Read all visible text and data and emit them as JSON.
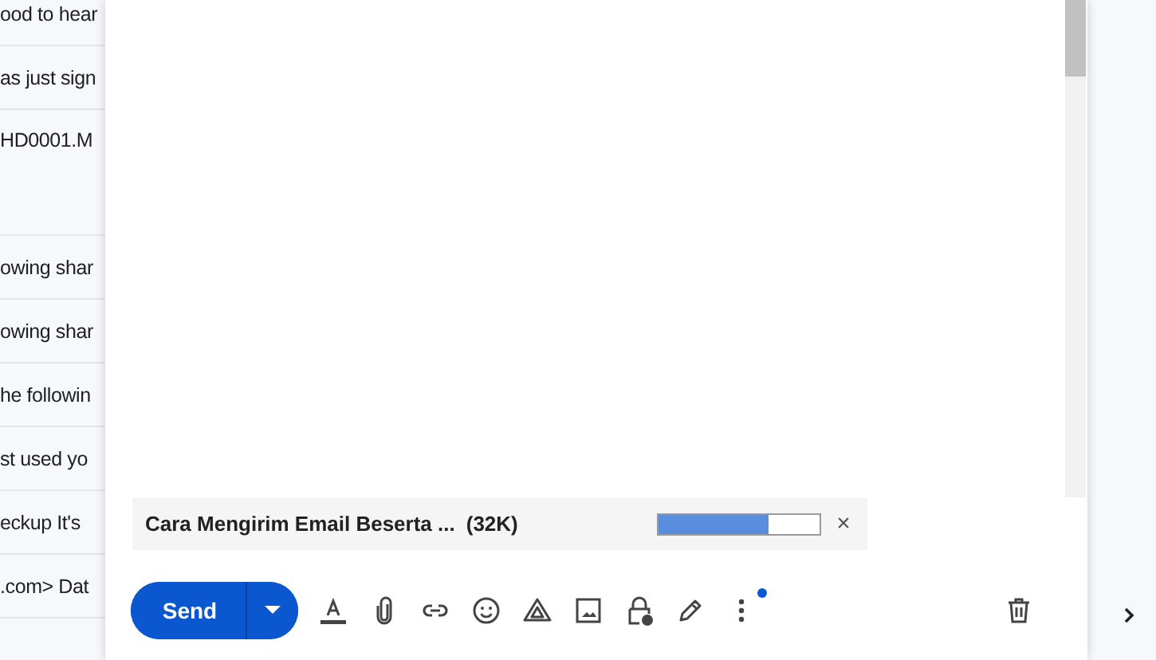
{
  "background_list": {
    "rows": [
      {
        "snippet": "ood to hear"
      },
      {
        "snippet": "as just sign"
      },
      {
        "snippet": "HD0001.M"
      },
      {
        "snippet": "owing shar"
      },
      {
        "snippet": "owing shar"
      },
      {
        "snippet": "he followin"
      },
      {
        "snippet": "st used yo"
      },
      {
        "snippet": "eckup It's"
      },
      {
        "snippet": ".com> Dat"
      }
    ]
  },
  "compose": {
    "attachment": {
      "name": "Cara Mengirim Email Beserta ...",
      "size": "(32K)",
      "level": 0.68,
      "close": "×"
    },
    "send_button": {
      "label": "Send"
    },
    "more_options_badge": true
  }
}
